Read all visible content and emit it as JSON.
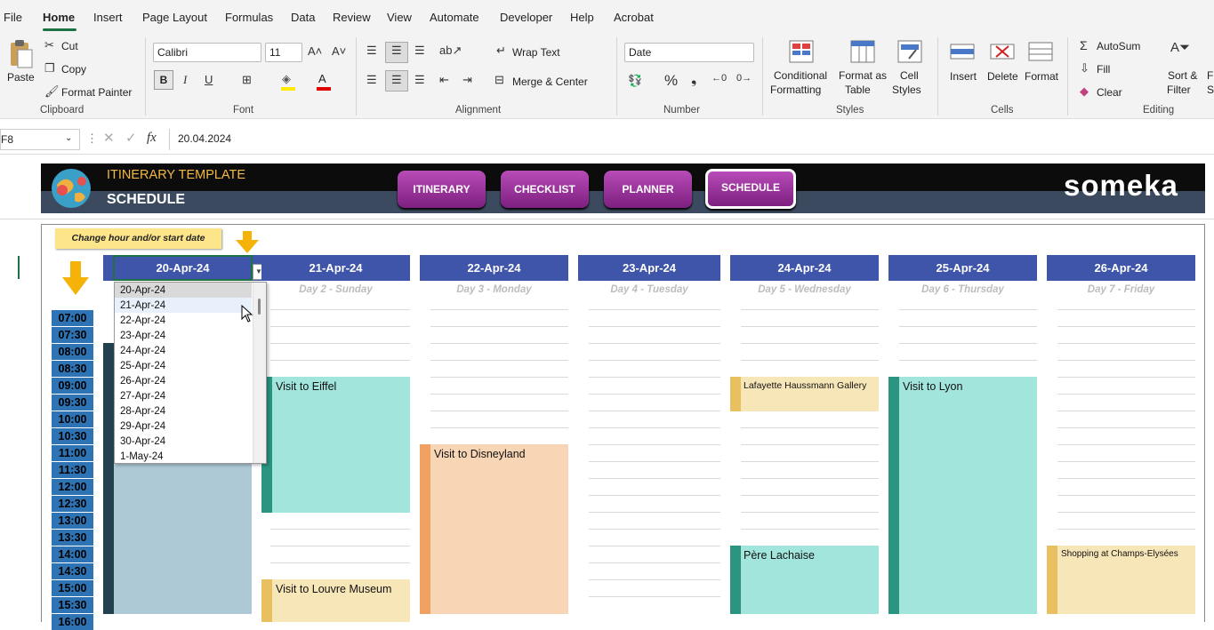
{
  "menu": {
    "items": [
      "File",
      "Home",
      "Insert",
      "Page Layout",
      "Formulas",
      "Data",
      "Review",
      "View",
      "Automate",
      "Developer",
      "Help",
      "Acrobat"
    ],
    "active": "Home"
  },
  "ribbon": {
    "clipboard": {
      "paste": "Paste",
      "cut": "Cut",
      "copy": "Copy",
      "format_painter": "Format Painter",
      "label": "Clipboard"
    },
    "font": {
      "name": "Calibri",
      "size": "11",
      "label": "Font"
    },
    "alignment": {
      "wrap": "Wrap Text",
      "merge": "Merge & Center",
      "label": "Alignment"
    },
    "number": {
      "format": "Date",
      "label": "Number"
    },
    "styles": {
      "conditional": "Conditional",
      "formatting": "Formatting",
      "format_as": "Format as",
      "table": "Table",
      "cell": "Cell",
      "styles": "Styles",
      "label": "Styles"
    },
    "cells": {
      "insert": "Insert",
      "delete": "Delete",
      "format": "Format",
      "label": "Cells"
    },
    "editing": {
      "autosum": "AutoSum",
      "fill": "Fill",
      "clear": "Clear",
      "sort": "Sort &",
      "filter": "Filter",
      "find": "Fi",
      "select": "Se",
      "label": "Editing"
    }
  },
  "formula_bar": {
    "cell_ref": "F8",
    "fx": "fx",
    "value": "20.04.2024"
  },
  "banner": {
    "title": "ITINERARY TEMPLATE",
    "subtitle": "SCHEDULE",
    "brand": "someka",
    "nav": [
      "ITINERARY",
      "CHECKLIST",
      "PLANNER",
      "SCHEDULE"
    ],
    "current": "SCHEDULE"
  },
  "note": "Change hour and/or start date",
  "days": [
    {
      "date": "20-Apr-24",
      "label": ""
    },
    {
      "date": "21-Apr-24",
      "label": "Day 2 - Sunday"
    },
    {
      "date": "22-Apr-24",
      "label": "Day 3 - Monday"
    },
    {
      "date": "23-Apr-24",
      "label": "Day 4 - Tuesday"
    },
    {
      "date": "24-Apr-24",
      "label": "Day 5 - Wednesday"
    },
    {
      "date": "25-Apr-24",
      "label": "Day 6 - Thursday"
    },
    {
      "date": "26-Apr-24",
      "label": "Day 7 - Friday"
    }
  ],
  "times": [
    "07:00",
    "07:30",
    "08:00",
    "08:30",
    "09:00",
    "09:30",
    "10:00",
    "10:30",
    "11:00",
    "11:30",
    "12:00",
    "12:30",
    "13:00",
    "13:30",
    "14:00",
    "14:30",
    "15:00",
    "15:30",
    "16:00"
  ],
  "events": [
    {
      "title": "Visit to Eiffel",
      "color": "#a1e5dc",
      "bar": "#2a9480"
    },
    {
      "title": "Visit to Louvre Museum",
      "color": "#f7e6b8",
      "bar": "#e8c060"
    },
    {
      "title": "Visit to Disneyland",
      "color": "#f8d5b5",
      "bar": "#f0a060"
    },
    {
      "title": "Lafayette Haussmann Gallery",
      "color": "#f7e6b8",
      "bar": "#e8c060"
    },
    {
      "title": "Père Lachaise",
      "color": "#a1e5dc",
      "bar": "#2a9480"
    },
    {
      "title": "Visit to Lyon",
      "color": "#a1e5dc",
      "bar": "#2a9480"
    },
    {
      "title": "Shopping at Champs-Elysées",
      "color": "#f7e6b8",
      "bar": "#e8c060"
    },
    {
      "title": "",
      "color": "#adc9d6",
      "bar": "#23404e"
    }
  ],
  "dropdown": [
    "20-Apr-24",
    "21-Apr-24",
    "22-Apr-24",
    "23-Apr-24",
    "24-Apr-24",
    "25-Apr-24",
    "26-Apr-24",
    "27-Apr-24",
    "28-Apr-24",
    "29-Apr-24",
    "30-Apr-24",
    "1-May-24"
  ]
}
